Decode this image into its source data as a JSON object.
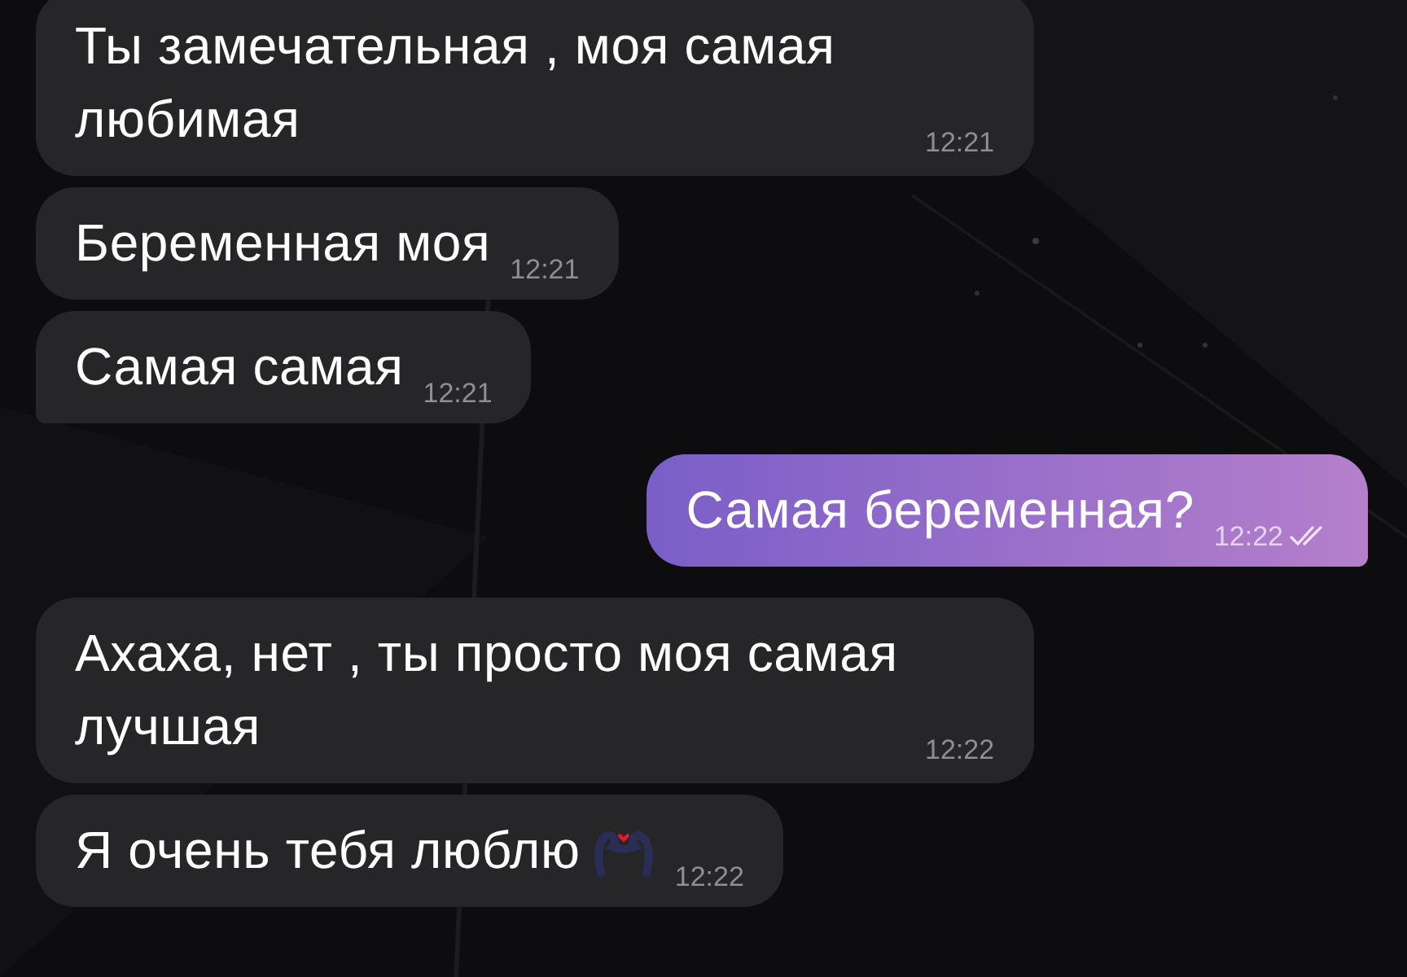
{
  "messages": [
    {
      "outgoing": false,
      "kind": "stacked",
      "text": "Ты замечательная , моя самая любимая",
      "time": "12:21",
      "tail": false
    },
    {
      "outgoing": false,
      "kind": "inline",
      "text": "Беременная моя",
      "time": "12:21",
      "tail": false
    },
    {
      "outgoing": false,
      "kind": "inline",
      "text": "Самая самая",
      "time": "12:21",
      "tail": true
    },
    {
      "outgoing": true,
      "kind": "inline",
      "text": "Самая беременная?",
      "time": "12:22",
      "read": true,
      "tail": true
    },
    {
      "outgoing": false,
      "kind": "stacked",
      "text": "Ахаха, нет , ты просто моя самая лучшая",
      "time": "12:22",
      "tail": false
    },
    {
      "outgoing": false,
      "kind": "inline",
      "text": "Я очень тебя люблю",
      "emoji": true,
      "time": "12:22",
      "tail": false
    }
  ]
}
